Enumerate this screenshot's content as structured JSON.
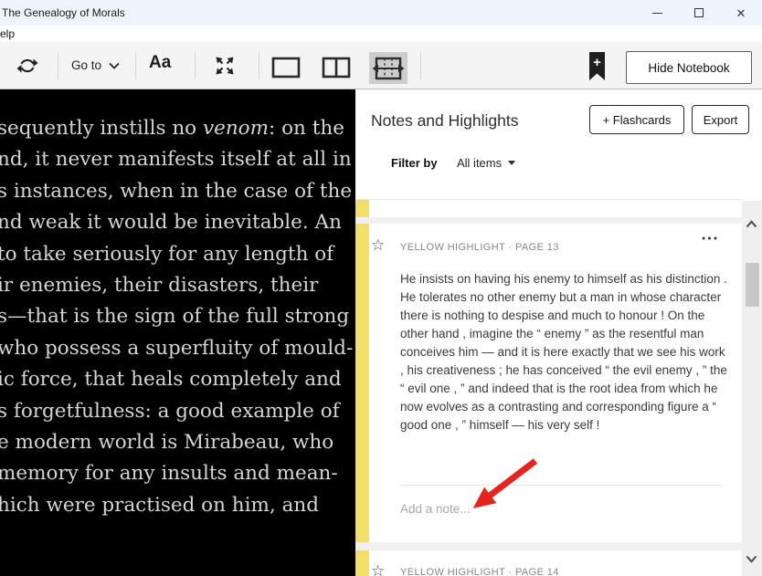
{
  "window": {
    "title": "The Genealogy of Morals"
  },
  "menubar": {
    "help_partial": "elp"
  },
  "toolbar": {
    "goto_label": "Go to",
    "font_settings_label": "Aa",
    "hide_notebook_label": "Hide Notebook"
  },
  "icons": {
    "close": "✕",
    "bookmark_plus": "+",
    "star_outline": "☆",
    "overflow_menu": "●●●"
  },
  "book": {
    "line1": {
      "pre": "sequently instills no ",
      "italic": "venom",
      "post": ": on the"
    },
    "lines": [
      "nd, it never manifests itself at all in",
      "s instances, when in the case of the",
      "nd weak it would be inevitable. An",
      "to take seriously for any length of",
      "ir enemies, their disasters, their",
      "s—that is the sign of the full strong",
      "who possess a superfluity of mould-",
      "ic force, that heals completely and",
      "s forgetfulness: a good example of",
      "e modern world is Mirabeau, who",
      "memory for any insults and mean-",
      "hich were practised on him, and"
    ]
  },
  "notebook": {
    "title": "Notes and Highlights",
    "flashcards_button": "+ Flashcards",
    "export_button": "Export",
    "filter_label": "Filter by",
    "filter_value": "All items",
    "card": {
      "label": "YELLOW HIGHLIGHT · PAGE 13",
      "text": "He insists on having his enemy to himself as his distinction . He tolerates no other enemy but a man in whose character there is nothing to despise and much to honour ! On the other hand , imagine the “ enemy ” as the resentful man conceives him — and it is here exactly that we see his work , his creativeness ; he has conceived “ the evil enemy , ” the “ evil one , ” and indeed that is the root idea from which he now evolves as a contrasting and corresponding figure a “ good one , ” himself — his very self !",
      "note_placeholder": "Add a note..."
    },
    "next_card": {
      "label": "YELLOW HIGHLIGHT · PAGE 14"
    }
  },
  "colors": {
    "highlight_yellow": "#f1de6d",
    "arrow_red": "#e3261d",
    "titlebar": "#eef5fc"
  }
}
